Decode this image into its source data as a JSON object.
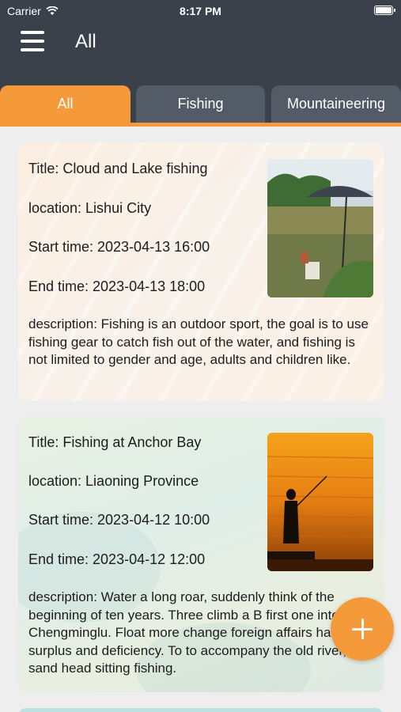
{
  "status_bar": {
    "carrier": "Carrier",
    "time": "8:17 PM"
  },
  "header": {
    "title": "All"
  },
  "tabs": [
    {
      "label": "All",
      "active": true
    },
    {
      "label": "Fishing",
      "active": false
    },
    {
      "label": "Mountaineering",
      "active": false
    }
  ],
  "colors": {
    "accent": "#f59a3a",
    "header_bg": "#3a414a",
    "tab_inactive": "#535b66"
  },
  "cards": [
    {
      "title": "Title: Cloud and Lake fishing",
      "location": "location: Lishui City",
      "start": "Start time: 2023-04-13 16:00",
      "end": "End time: 2023-04-13 18:00",
      "description": "description: Fishing is an outdoor sport, the goal is to use fishing gear to catch fish out of the water, and fishing is not limited to gender and age, adults and children like.",
      "image": "lake-umbrella-photo"
    },
    {
      "title": "Title: Fishing at Anchor Bay",
      "location": "location: Liaoning Province",
      "start": "Start time: 2023-04-12 10:00",
      "end": "End time: 2023-04-12 12:00",
      "description": "description: Water a long roar, suddenly think of the beginning of ten years. Three climb a B first one into the Chengminglu. Float more change foreign affairs have surplus and deficiency. To to accompany the old river, sand head sitting fishing.",
      "image": "sunset-angler-photo"
    }
  ],
  "fab": {
    "icon": "plus-icon"
  }
}
